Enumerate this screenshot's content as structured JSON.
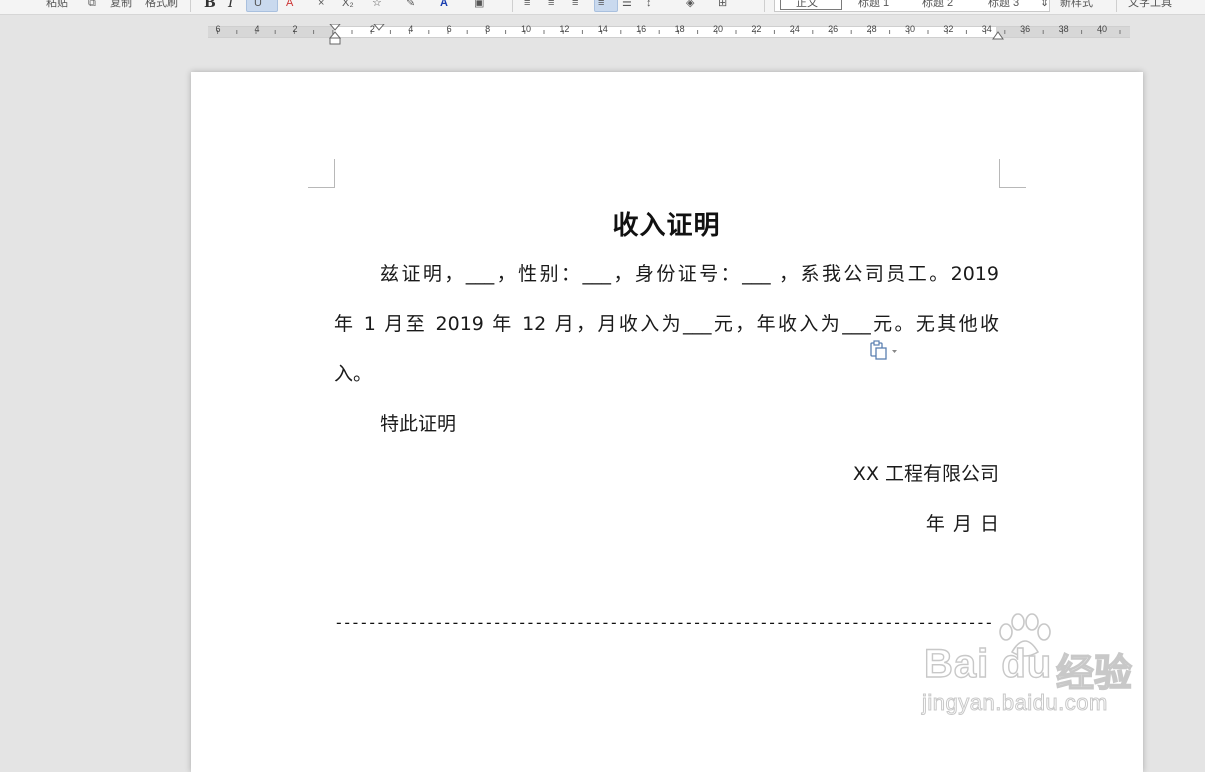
{
  "toolbar": {
    "paste_label": "粘贴",
    "copy_label": "复制",
    "format_painter_label": "格式刷",
    "bold_label": "B",
    "italic_label": "I",
    "underline_label": "U",
    "strike_label": "A",
    "clear_label": "×",
    "subscript_label": "X₂",
    "font_color_label": "A",
    "styles": [
      "正文",
      "标题 1",
      "标题 2",
      "标题 3"
    ],
    "new_style_label": "新样式",
    "text_tools_label": "文字工具"
  },
  "ruler": {
    "left_numbers": [
      "6",
      "4",
      "2"
    ],
    "right_numbers": [
      "2",
      "4",
      "6",
      "8",
      "10",
      "12",
      "14",
      "16",
      "18",
      "20",
      "22",
      "24",
      "26",
      "28",
      "30",
      "32",
      "34",
      "36",
      "38",
      "40"
    ]
  },
  "document": {
    "title": "收入证明",
    "line1": "兹证明，___，性别：___，身份证号：___ ，系我公司员工。2019",
    "line2": "年 1 月至 2019 年 12 月，月收入为___元，年收入为___元。无其他收",
    "line3": "入。",
    "closing": "特此证明",
    "company": "XX 工程有限公司",
    "date": "年  月  日",
    "separator": "--------------------------------------------------------------------------------------------------------"
  },
  "watermark": {
    "brand": "Bai du",
    "brand_cn": "经验",
    "url": "jingyan.baidu.com"
  }
}
